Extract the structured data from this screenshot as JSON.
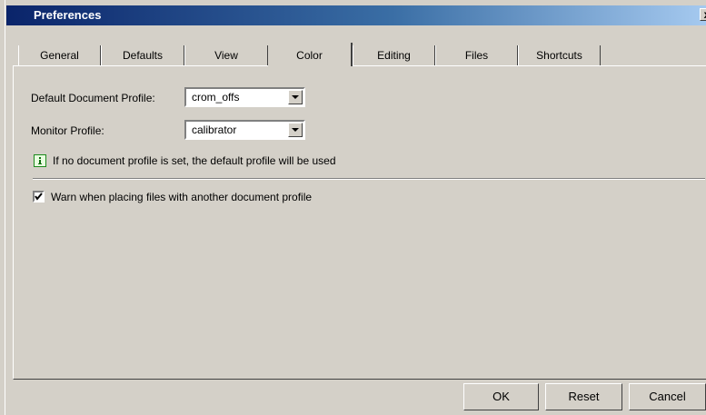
{
  "window": {
    "title": "Preferences",
    "close_glyph": "x"
  },
  "tabs": [
    {
      "label": "General"
    },
    {
      "label": "Defaults"
    },
    {
      "label": "View"
    },
    {
      "label": "Color",
      "active": true
    },
    {
      "label": "Editing"
    },
    {
      "label": "Files"
    },
    {
      "label": "Shortcuts"
    }
  ],
  "color": {
    "default_profile_label": "Default Document Profile:",
    "default_profile_value": "crom_offs",
    "monitor_profile_label": "Monitor Profile:",
    "monitor_profile_value": "calibrator",
    "info_text": "If no document profile is set, the default profile will be used",
    "warn_label": "Warn when placing files with another document profile",
    "warn_checked": true
  },
  "buttons": {
    "ok": "OK",
    "reset": "Reset",
    "cancel": "Cancel"
  },
  "icons": {
    "info": "info-icon",
    "dropdown": "chevron-down-icon",
    "check": "check-icon"
  }
}
